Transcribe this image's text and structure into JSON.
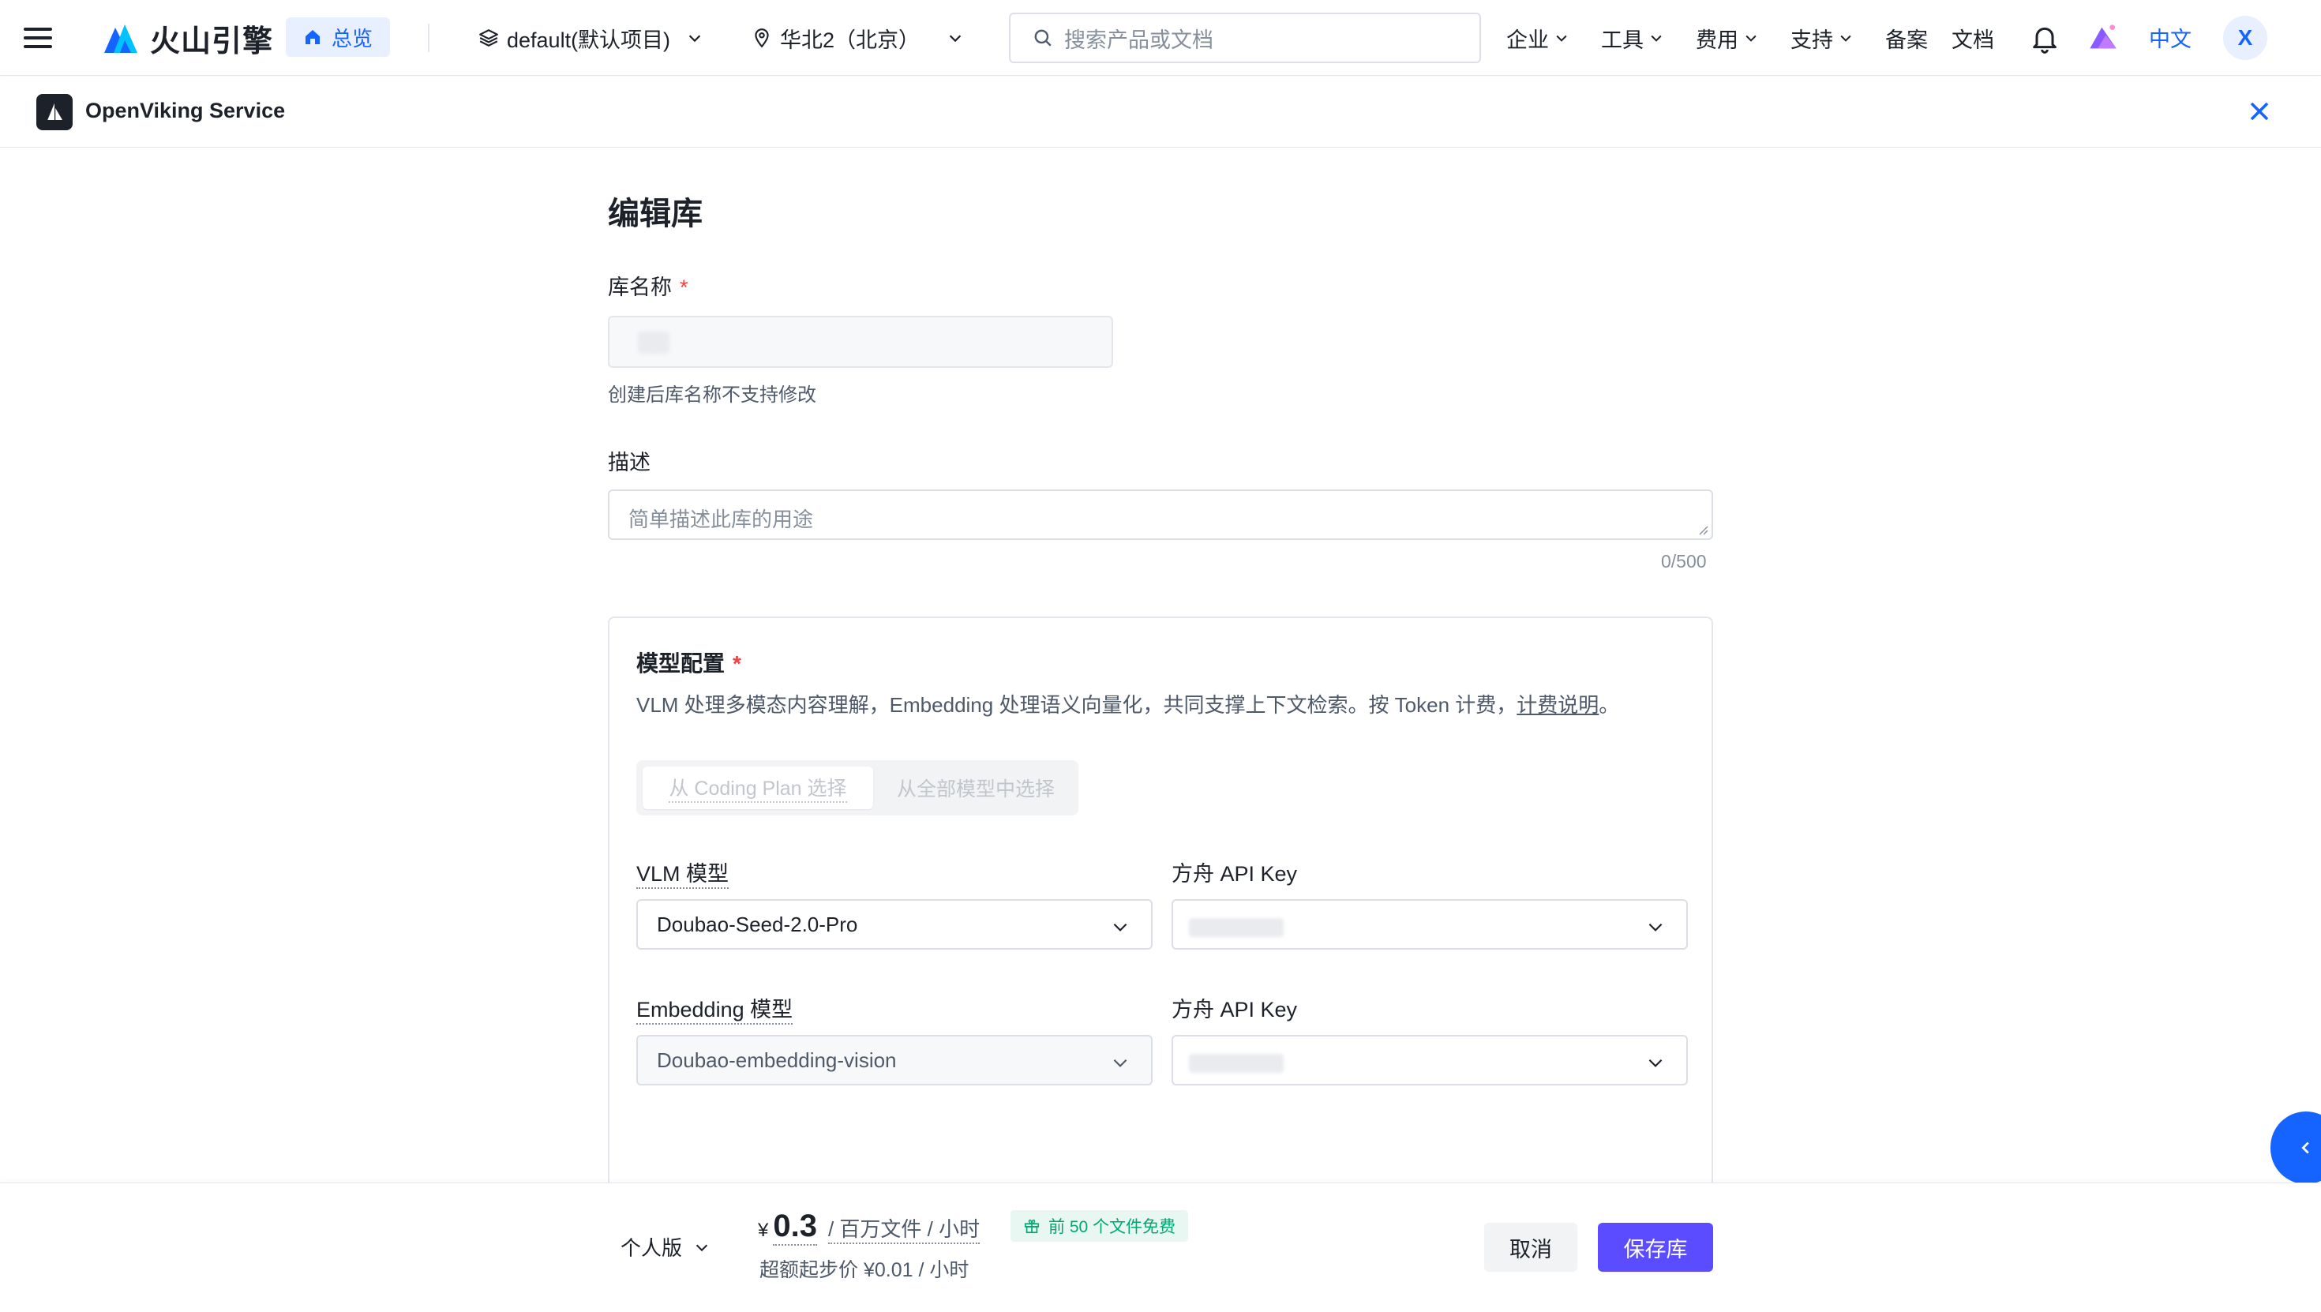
{
  "nav": {
    "logo_text": "火山引擎",
    "home_label": "总览",
    "project_label": "default(默认项目)",
    "region_label": "华北2（北京）",
    "search_placeholder": "搜索产品或文档",
    "menus": [
      "企业",
      "工具",
      "费用",
      "支持"
    ],
    "record_label": "备案",
    "docs_label": "文档",
    "lang_label": "中文",
    "avatar_letter": "X"
  },
  "service": {
    "name": "OpenViking Service"
  },
  "form": {
    "title": "编辑库",
    "name_label": "库名称",
    "required_mark": "*",
    "name_hint": "创建后库名称不支持修改",
    "desc_label": "描述",
    "desc_placeholder": "简单描述此库的用途",
    "desc_counter": "0/500"
  },
  "model_config": {
    "title": "模型配置",
    "required_mark": "*",
    "description": "VLM 处理多模态内容理解，Embedding 处理语义向量化，共同支撑上下文检索。按 Token 计费，",
    "billing_link": "计费说明",
    "description_end": "。",
    "tabs": [
      "从 Coding Plan 选择",
      "从全部模型中选择"
    ],
    "vlm_label": "VLM 模型",
    "vlm_value": "Doubao-Seed-2.0-Pro",
    "vlm_key_label": "方舟 API Key",
    "embedding_label": "Embedding 模型",
    "embedding_value": "Doubao-embedding-vision",
    "embedding_key_label": "方舟 API Key"
  },
  "footer": {
    "edition": "个人版",
    "currency": "¥",
    "price": "0.3",
    "unit": "/ 百万文件 / 小时",
    "free_badge": "前 50 个文件免费",
    "overage": "超额起步价 ¥0.01 / 小时",
    "cancel": "取消",
    "save": "保存库"
  },
  "colors": {
    "brand_blue": "#1664ff",
    "save_button": "#5b4cff",
    "required": "#f53f3f",
    "free_badge_text": "#00a870"
  }
}
